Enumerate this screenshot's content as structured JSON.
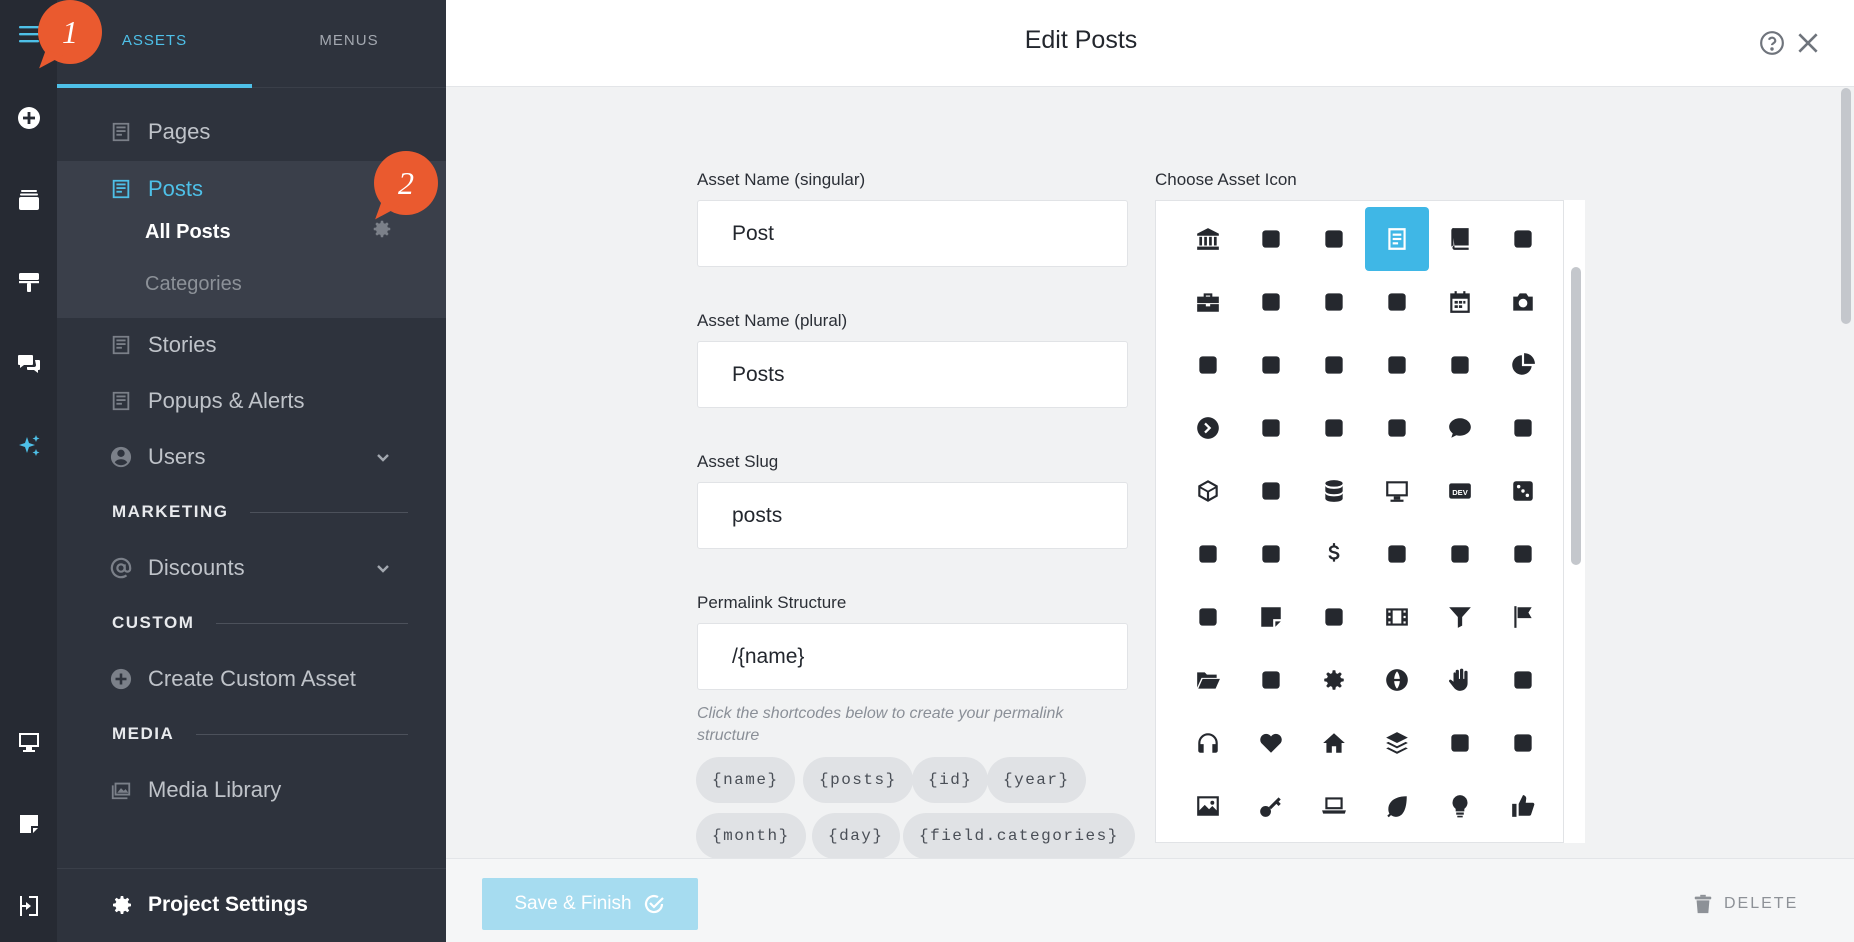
{
  "rail": {
    "items": [
      {
        "icon": "hamburger-menu-icon"
      },
      {
        "icon": "plus-circle-icon"
      },
      {
        "icon": "layers-icon"
      },
      {
        "icon": "paint-roller-icon"
      },
      {
        "icon": "comments-icon"
      },
      {
        "icon": "sparkles-icon"
      },
      {
        "icon": "monitor-icon"
      },
      {
        "icon": "sticky-note-icon"
      },
      {
        "icon": "sign-out-icon"
      }
    ]
  },
  "sidebar": {
    "tabs": [
      {
        "label": "ASSETS",
        "active": true
      },
      {
        "label": "MENUS",
        "active": false
      }
    ],
    "items": [
      {
        "label": "Pages",
        "icon": "page-icon"
      },
      {
        "label": "Posts",
        "icon": "page-icon",
        "active": true
      },
      {
        "label": "Stories",
        "icon": "page-icon"
      },
      {
        "label": "Popups & Alerts",
        "icon": "page-icon"
      },
      {
        "label": "Users",
        "icon": "user-circle-icon"
      },
      {
        "label": "Discounts",
        "icon": "at-sign-icon"
      },
      {
        "label": "Create Custom Asset",
        "icon": "plus-circle-icon"
      },
      {
        "label": "Media Library",
        "icon": "images-icon"
      }
    ],
    "posts_sub": {
      "all_posts": "All Posts",
      "categories": "Categories"
    },
    "sections": {
      "marketing": "MARKETING",
      "custom": "CUSTOM",
      "media": "MEDIA"
    },
    "project_settings": "Project Settings"
  },
  "annotations": {
    "one": "1",
    "two": "2"
  },
  "header": {
    "title": "Edit Posts"
  },
  "form": {
    "singular": {
      "label": "Asset Name (singular)",
      "value": "Post"
    },
    "plural": {
      "label": "Asset Name (plural)",
      "value": "Posts"
    },
    "slug": {
      "label": "Asset Slug",
      "value": "posts"
    },
    "permalink": {
      "label": "Permalink Structure",
      "value": "/{name}"
    },
    "hint": "Click the shortcodes below to create your permalink structure",
    "shortcodes": [
      "{name}",
      "{posts}",
      "{id}",
      "{year}",
      "{month}",
      "{day}",
      "{field.categories}"
    ]
  },
  "icon_picker": {
    "label": "Choose Asset Icon",
    "selected": "file-alt-icon",
    "icons": [
      "landmark-icon",
      "calendar-bolt-icon",
      "ticket-icon",
      "file-alt-icon",
      "book-icon",
      "archive-box-icon",
      "briefcase-icon",
      "highlighter-icon",
      "bug-icon",
      "calculator-icon",
      "calendar-icon",
      "camera-icon",
      "aperture-icon",
      "video-camera-icon",
      "chalkboard-icon",
      "car-icon",
      "gauge-icon",
      "chart-pie-icon",
      "chevron-circle-right-icon",
      "presentation-icon",
      "clipboard-check-icon",
      "paint-bucket-icon",
      "comment-icon",
      "css3-icon",
      "cube-icon",
      "dashboard-icon",
      "database-icon",
      "desktop-icon",
      "dev-icon",
      "dice-icon",
      "concierge-bell-icon",
      "receipt-icon",
      "dollar-icon",
      "drafting-compass-icon",
      "duck-icon",
      "envelope-open-icon",
      "faucet-icon",
      "sticky-note-icon",
      "inbox-download-icon",
      "film-icon",
      "filter-icon",
      "flag-icon",
      "folder-open-icon",
      "gamepad-icon",
      "gear-icon",
      "globe-icon",
      "hand-icon",
      "hands-helping-icon",
      "headphones-icon",
      "heart-icon",
      "home-icon",
      "layers-icon",
      "sitemap-icon",
      "house-user-icon",
      "image-icon",
      "key-icon",
      "laptop-icon",
      "leaf-icon",
      "lightbulb-icon",
      "thumbs-up-icon"
    ]
  },
  "footer": {
    "save_label": "Save & Finish",
    "delete_label": "DELETE"
  }
}
